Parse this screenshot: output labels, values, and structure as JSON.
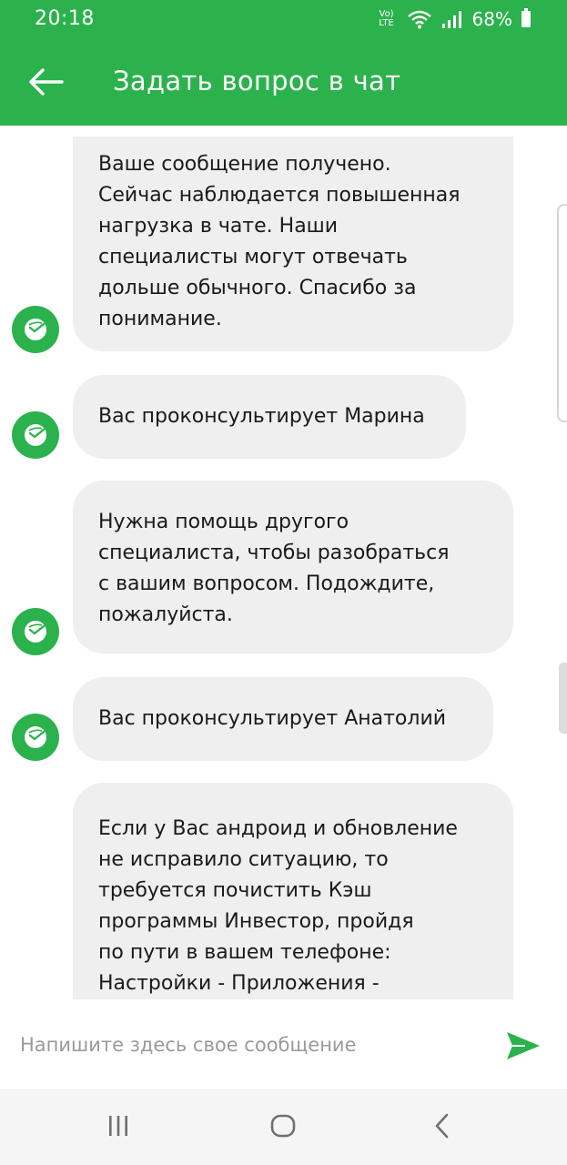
{
  "status_bar": {
    "time": "20:18",
    "network_label_top": "Vo)",
    "network_label_bottom": "LTE",
    "battery": "68%"
  },
  "app_bar": {
    "back_icon": "arrow-left-icon",
    "title": "Задать вопрос в чат"
  },
  "chat": {
    "messages": [
      {
        "text": "Ваше сообщение получено.\nСейчас наблюдается повышенная\nнагрузка в чате. Наши\nспециалисты могут отвечать\nдольше обычного. Спасибо за\nпонимание.",
        "avatar_icon": "sber-logo-icon"
      },
      {
        "text": "Вас проконсультирует Марина",
        "avatar_icon": "sber-logo-icon"
      },
      {
        "text": "Нужна помощь другого\nспециалиста, чтобы разобраться\nс вашим вопросом. Подождите,\nпожалуйста.",
        "avatar_icon": "sber-logo-icon"
      },
      {
        "text": "Вас проконсультирует Анатолий",
        "avatar_icon": "sber-logo-icon"
      },
      {
        "text": "Если у Вас андроид и обновление\nне исправило ситуацию, то\nтребуется почистить Кэш\nпрограммы Инвестор, пройдя\nпо пути в вашем телефоне:\nНастройки - Приложения -",
        "avatar_icon": "sber-logo-icon"
      }
    ]
  },
  "composer": {
    "placeholder": "Напишите здесь свое сообщение",
    "value": "",
    "send_icon": "send-icon"
  },
  "nav_bar": {
    "recents_icon": "recents-icon",
    "home_icon": "home-icon",
    "back_icon": "nav-back-icon"
  },
  "colors": {
    "brand_green": "#2bb24c",
    "bubble_bg": "#efefef",
    "text": "#1a1a1a",
    "placeholder": "#9a9a9a"
  }
}
